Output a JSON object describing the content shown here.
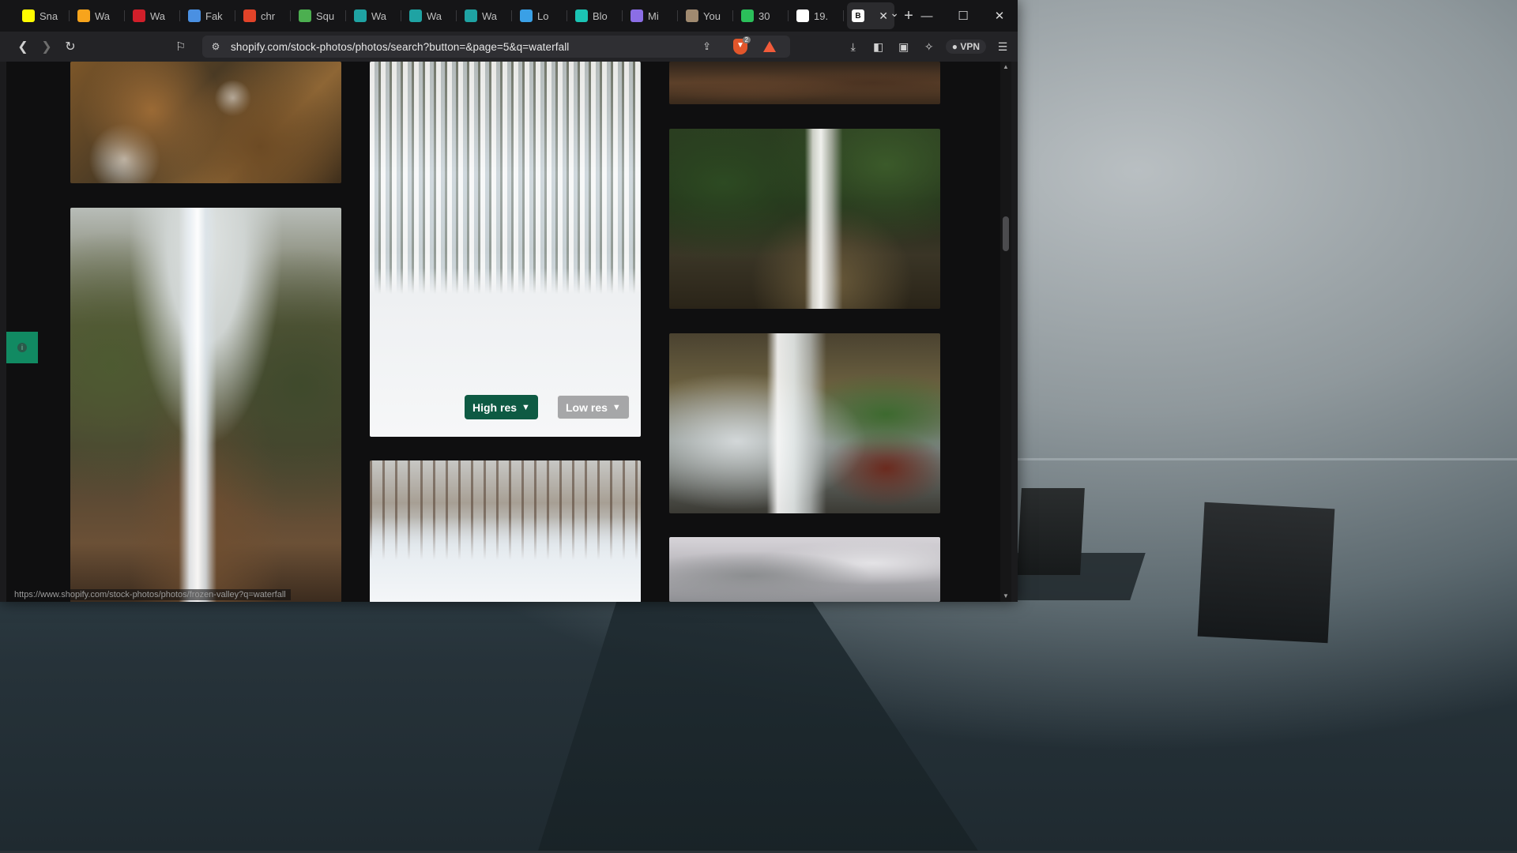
{
  "browser": {
    "tabs": [
      {
        "label": "Sna",
        "favicon": "snapchat-icon",
        "color": "#fffc00"
      },
      {
        "label": "Wa",
        "favicon": "hd-icon",
        "color": "#f7a41c"
      },
      {
        "label": "Wa",
        "favicon": "grid-icon",
        "color": "#d11f2a"
      },
      {
        "label": "Fak",
        "favicon": "doc-icon",
        "color": "#4a90e2"
      },
      {
        "label": "chr",
        "favicon": "gitlab-icon",
        "color": "#e24329"
      },
      {
        "label": "Squ",
        "favicon": "play-icon",
        "color": "#4caf50"
      },
      {
        "label": "Wa",
        "favicon": "s-icon",
        "color": "#1fa3a3"
      },
      {
        "label": "Wa",
        "favicon": "s-icon",
        "color": "#1fa3a3"
      },
      {
        "label": "Wa",
        "favicon": "s-icon",
        "color": "#1fa3a3"
      },
      {
        "label": "Lo",
        "favicon": "cloud-icon",
        "color": "#3aa0e6"
      },
      {
        "label": "Blo",
        "favicon": "b-icon",
        "color": "#1bc4b4"
      },
      {
        "label": "Mi",
        "favicon": "copilot-icon",
        "color": "#8b6ee6"
      },
      {
        "label": "You",
        "favicon": "photo-icon",
        "color": "#a08a70"
      },
      {
        "label": "30",
        "favicon": "px-icon",
        "color": "#2bbf5a"
      },
      {
        "label": "19.",
        "favicon": "is-icon",
        "color": "#ffffff"
      }
    ],
    "active_tab": {
      "label": "B",
      "favicon": "b-icon"
    },
    "new_tab": "+",
    "url": "shopify.com/stock-photos/photos/search?button=&page=5&q=waterfall",
    "shield_count": "2",
    "vpn_label": "VPN",
    "status_url": "https://www.shopify.com/stock-photos/photos/frozen-valley?q=waterfall"
  },
  "gallery": {
    "hovered_photo": {
      "high_res_label": "High res",
      "low_res_label": "Low res"
    }
  },
  "colors": {
    "high_res_button": "#0e5a43",
    "feedback_tab": "#118a62"
  }
}
